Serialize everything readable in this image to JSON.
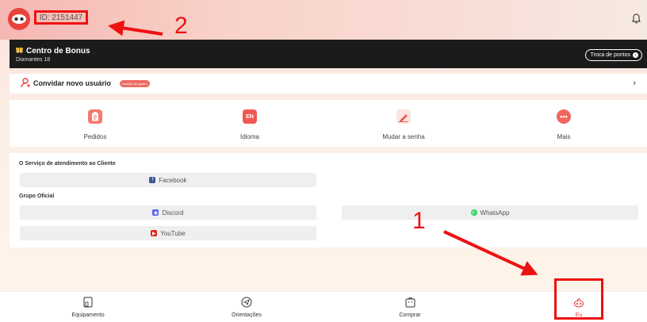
{
  "header": {
    "id_text": "ID: 2151447"
  },
  "bonus": {
    "title": "Centro de Bonus",
    "subtitle": "Diamantes 18",
    "action": "Troca de pontos"
  },
  "invite": {
    "label": "Convidar novo usuário",
    "badge": "Doação de ganho"
  },
  "menu": {
    "items": [
      {
        "label": "Pedidos",
        "icon": "clipboard-icon"
      },
      {
        "label": "Idioma",
        "icon": "language-icon",
        "glyph": "EN"
      },
      {
        "label": "Mudar a senha",
        "icon": "pencil-icon"
      },
      {
        "label": "Mais",
        "icon": "more-icon"
      }
    ]
  },
  "service": {
    "title": "O Serviço de atendimento ao Cliente",
    "facebook": "Facebook",
    "group_title": "Grupo Oficial",
    "discord": "Discord",
    "whatsapp": "WhatsApp",
    "youtube": "YouTube"
  },
  "nav": {
    "items": [
      {
        "label": "Equipamento",
        "icon": "device-icon"
      },
      {
        "label": "Orientações",
        "icon": "compass-icon"
      },
      {
        "label": "Comprar",
        "icon": "shopping-bag-icon"
      },
      {
        "label": "Eu",
        "icon": "profile-logo-icon"
      }
    ]
  },
  "annotations": {
    "marker_1": "1",
    "marker_2": "2"
  },
  "colors": {
    "accent": "#e8433a",
    "annotation": "#e11111"
  }
}
